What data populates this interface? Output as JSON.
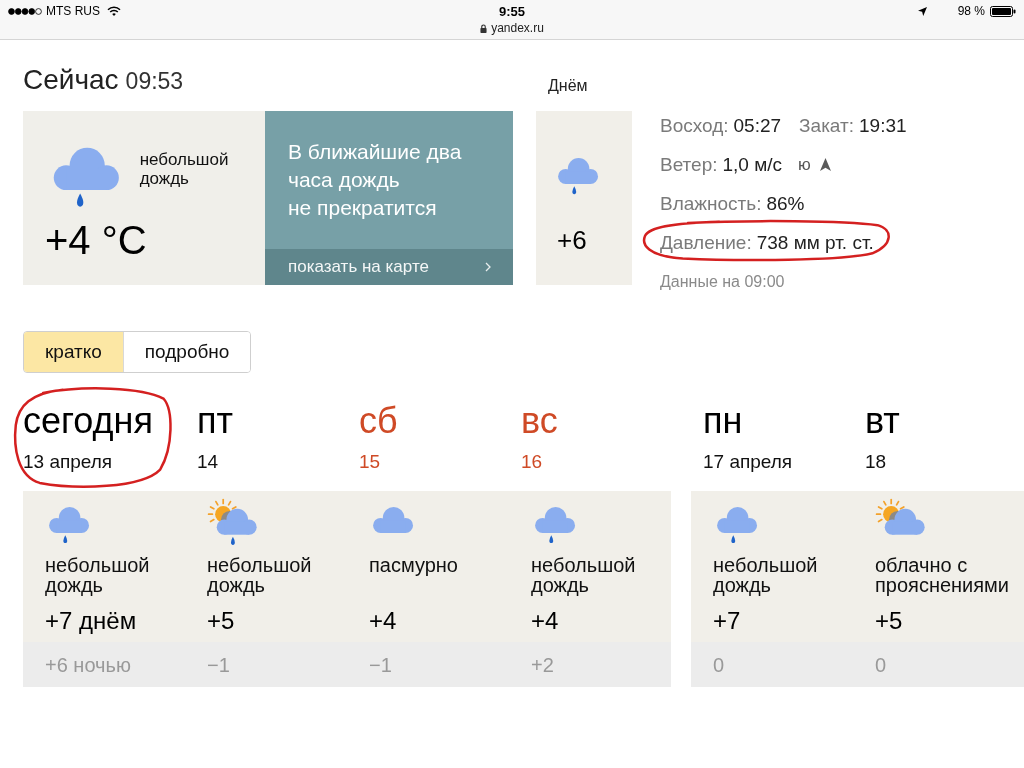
{
  "status_bar": {
    "carrier": "MTS RUS",
    "time": "9:55",
    "url": "yandex.ru",
    "battery": "98 %"
  },
  "now": {
    "title": "Сейчас",
    "time": "09:53",
    "kind": "rain",
    "condition": "небольшой дождь",
    "temperature": "+4 °C"
  },
  "nowcast": {
    "message": "В ближайшие два\nчаса дождь\nне прекратится",
    "link": "показать на карте"
  },
  "daytime": {
    "label": "Днём",
    "kind": "rain",
    "temperature": "+6"
  },
  "details": {
    "rows": [
      {
        "parts": [
          {
            "label": "Восход:",
            "value": "05:27"
          },
          {
            "label": "Закат:",
            "value": "19:31"
          }
        ],
        "circled": false
      },
      {
        "parts": [
          {
            "label": "Ветер:",
            "value": "1,0 м/с"
          }
        ],
        "direction": "ю",
        "circled": false
      },
      {
        "parts": [
          {
            "label": "Влажность:",
            "value": "86%"
          }
        ],
        "circled": false
      },
      {
        "parts": [
          {
            "label": "Давление:",
            "value": "738 мм рт. ст."
          }
        ],
        "circled": true
      }
    ],
    "updated": "Данные на 09:00"
  },
  "view_tabs": [
    {
      "label": "кратко",
      "selected": true
    },
    {
      "label": "подробно",
      "selected": false
    }
  ],
  "weeks": [
    {
      "days": [
        {
          "name": "сегодня",
          "date": "13 апреля",
          "weekend": false,
          "circled": true,
          "kind": "rain",
          "condition": "небольшой дождь",
          "day_temp": "+7 днём",
          "night_temp": "+6 ночью"
        },
        {
          "name": "пт",
          "date": "14",
          "weekend": false,
          "circled": false,
          "kind": "sun-rain",
          "condition": "небольшой дождь",
          "day_temp": "+5",
          "night_temp": "−1"
        },
        {
          "name": "сб",
          "date": "15",
          "weekend": true,
          "circled": false,
          "kind": "cloud",
          "condition": "пасмурно",
          "day_temp": "+4",
          "night_temp": "−1"
        },
        {
          "name": "вс",
          "date": "16",
          "weekend": true,
          "circled": false,
          "kind": "rain",
          "condition": "небольшой дождь",
          "day_temp": "+4",
          "night_temp": "+2"
        }
      ]
    },
    {
      "days": [
        {
          "name": "пн",
          "date": "17 апреля",
          "weekend": false,
          "circled": false,
          "kind": "rain",
          "condition": "небольшой дождь",
          "day_temp": "+7",
          "night_temp": "0"
        },
        {
          "name": "вт",
          "date": "18",
          "weekend": false,
          "circled": false,
          "kind": "sun-cloud",
          "condition": "облачно с прояснениями",
          "day_temp": "+5",
          "night_temp": "0"
        }
      ]
    }
  ]
}
